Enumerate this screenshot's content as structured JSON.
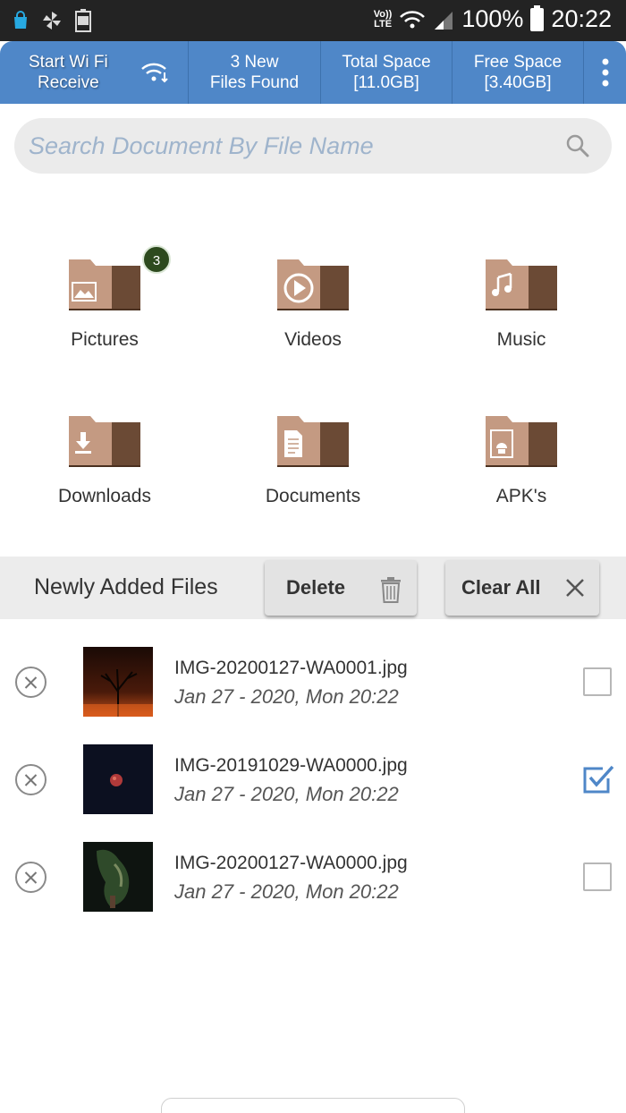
{
  "status_bar": {
    "volte_top": "Vo))",
    "volte_bottom": "LTE",
    "battery_percent": "100%",
    "time": "20:22",
    "left_icons": [
      "shopping-bag-icon",
      "pinwheel-icon",
      "battery-100-icon"
    ],
    "colors": {
      "background": "#232323",
      "shopping_bag": "#27a9e1"
    }
  },
  "top_bar": {
    "wifi_receive_line1": "Start Wi Fi",
    "wifi_receive_line2": "Receive",
    "new_files_line1": "3 New",
    "new_files_line2": "Files Found",
    "total_space_line1": "Total Space",
    "total_space_line2": "[11.0GB]",
    "free_space_line1": "Free Space",
    "free_space_line2": "[3.40GB]",
    "colors": {
      "background": "#4f87c8"
    }
  },
  "search": {
    "placeholder": "Search Document By File Name",
    "value": ""
  },
  "categories": [
    {
      "label": "Pictures",
      "icon": "picture-folder-icon",
      "badge": "3"
    },
    {
      "label": "Videos",
      "icon": "video-folder-icon"
    },
    {
      "label": "Music",
      "icon": "music-folder-icon"
    },
    {
      "label": "Downloads",
      "icon": "download-folder-icon"
    },
    {
      "label": "Documents",
      "icon": "document-folder-icon"
    },
    {
      "label": "APK's",
      "icon": "apk-folder-icon"
    }
  ],
  "newly_added": {
    "title": "Newly Added Files",
    "delete_label": "Delete",
    "clear_all_label": "Clear All"
  },
  "files": [
    {
      "name": "IMG-20200127-WA0001.jpg",
      "date": "Jan 27 - 2020, Mon 20:22",
      "checked": false
    },
    {
      "name": "IMG-20191029-WA0000.jpg",
      "date": "Jan 27 - 2020, Mon 20:22",
      "checked": true
    },
    {
      "name": "IMG-20200127-WA0000.jpg",
      "date": "Jan 27 - 2020, Mon 20:22",
      "checked": false
    }
  ],
  "colors": {
    "folder_light": "#c49a82",
    "folder_dark": "#6b4a35",
    "accent": "#4f87c8",
    "badge": "#2d4a1e"
  }
}
